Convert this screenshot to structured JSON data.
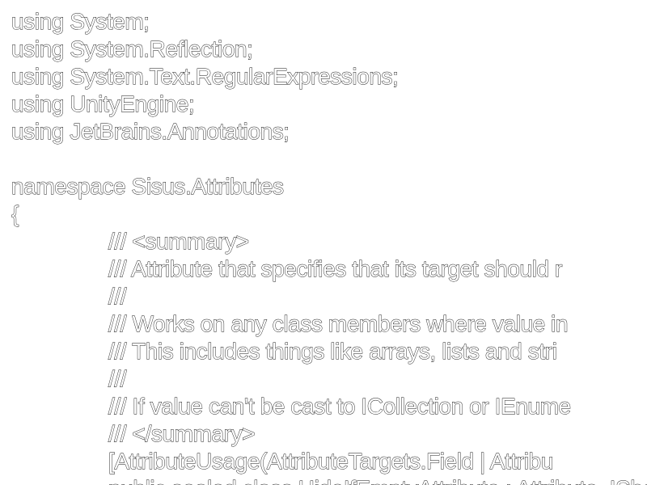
{
  "editor": {
    "lines": [
      "using System;",
      "using System.Reflection;",
      "using System.Text.RegularExpressions;",
      "using UnityEngine;",
      "using JetBrains.Annotations;",
      "",
      "namespace Sisus.Attributes",
      "{",
      "/// <summary>",
      "/// Attribute that specifies that its target should r",
      "///",
      "/// Works on any class members where value in",
      "/// This includes things like arrays, lists and stri",
      "///",
      "/// If value can't be cast to ICollection or IEnume",
      "/// </summary>",
      "[AttributeUsage(AttributeTargets.Field | Attribu",
      "public sealed class HideIfEmptyAttribute : Attribute, IShowInspectorIf"
    ]
  }
}
